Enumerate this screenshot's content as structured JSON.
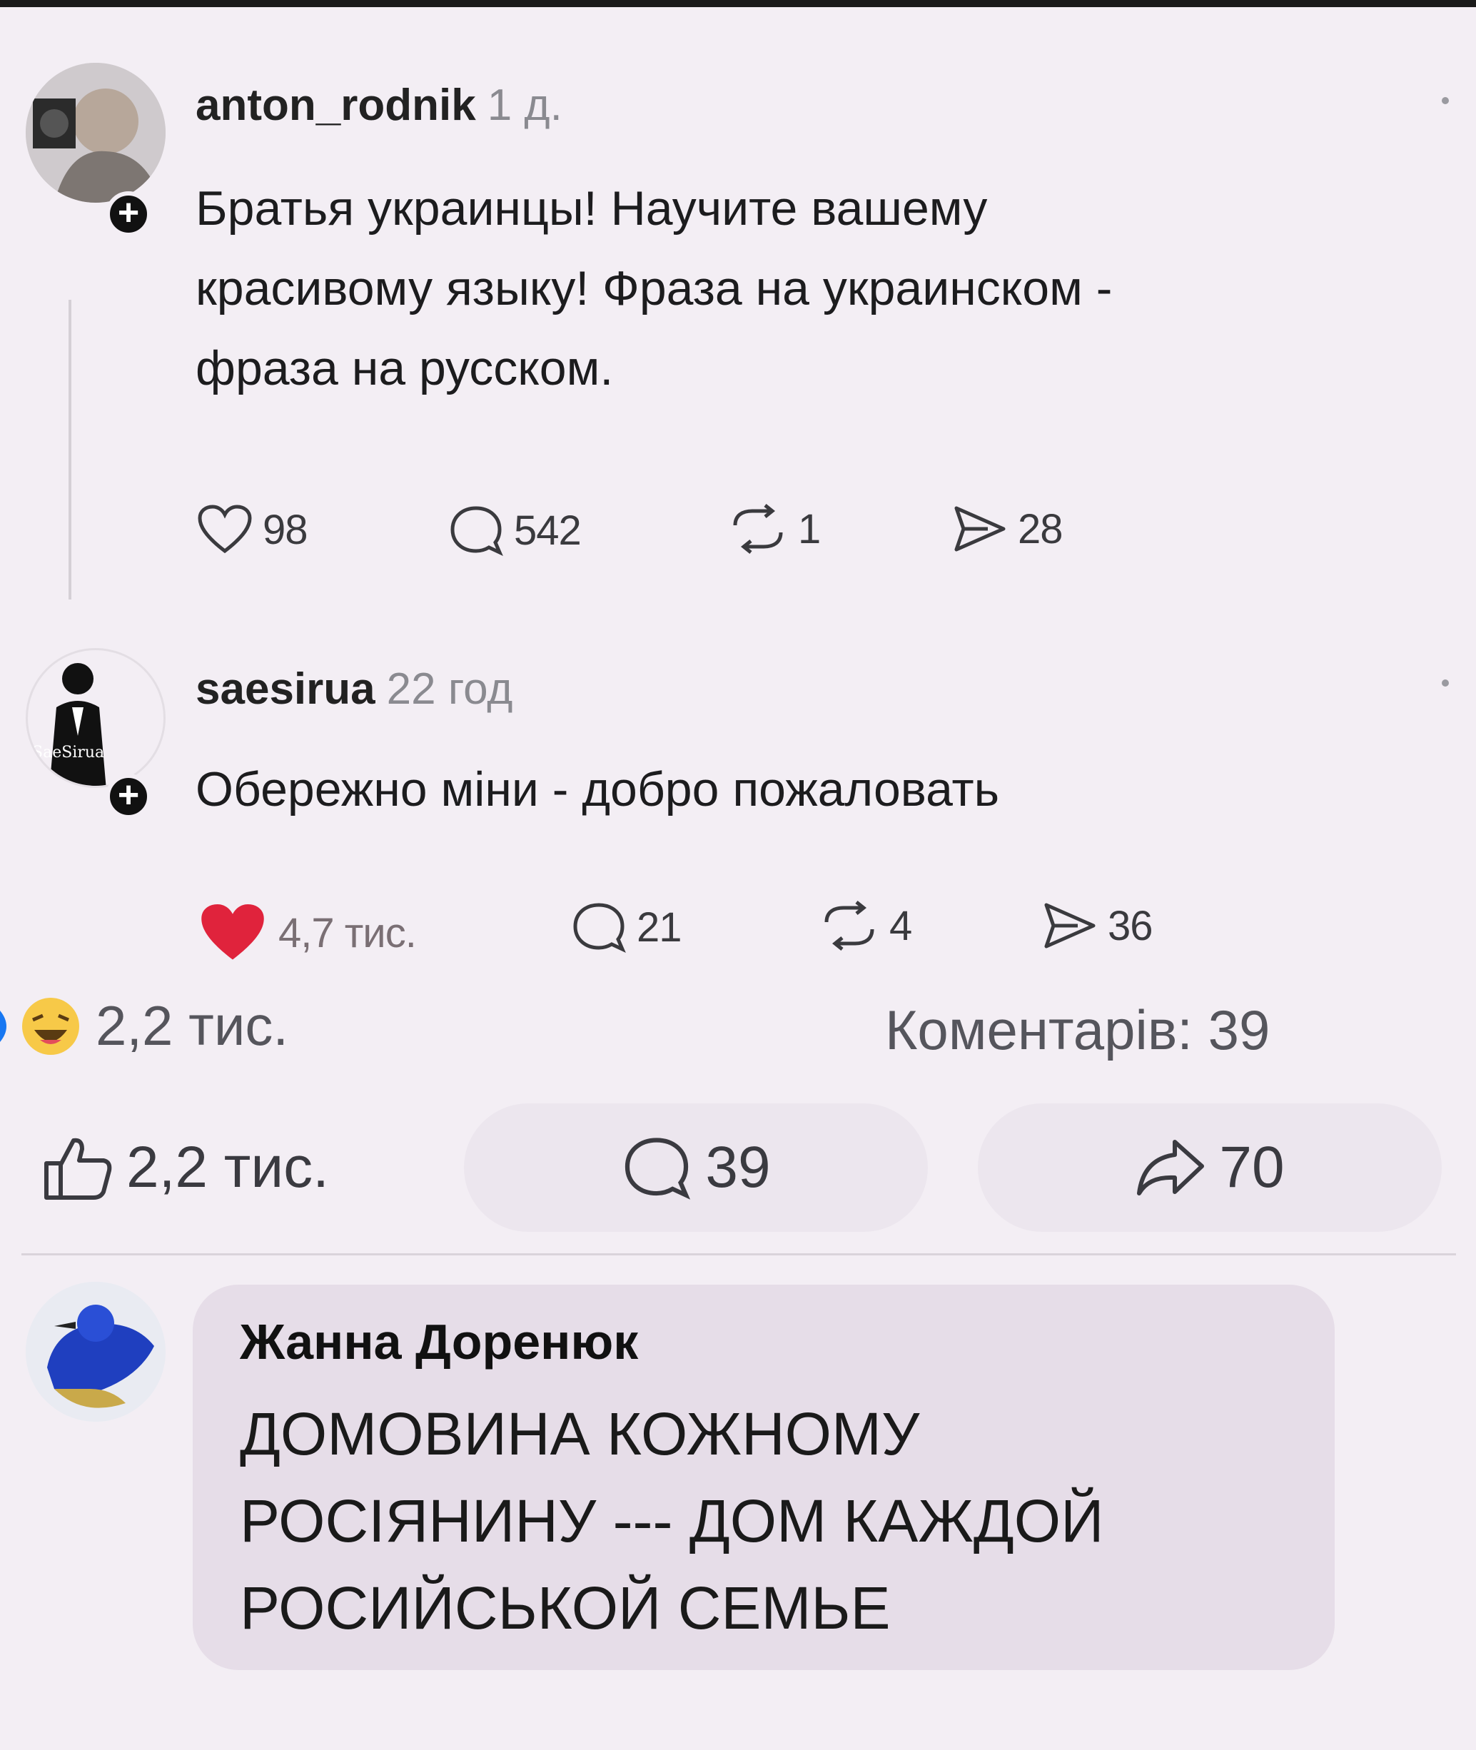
{
  "post1": {
    "username": "anton_rodnik",
    "time": "1 д.",
    "text_lines": [
      "Братья украинцы! Научите вашему",
      "красивому языку! Фраза на украинском -",
      "фраза на русском."
    ],
    "likes": "98",
    "comments": "542",
    "reposts": "1",
    "shares": "28"
  },
  "post2": {
    "username": "saesirua",
    "time": "22 год",
    "avatar_caption": "SaeSirua",
    "text": "Обережно міни - добро пожаловать",
    "likes": "4,7 тис.",
    "comments": "21",
    "reposts": "4",
    "shares": "36"
  },
  "summary": {
    "reactions_count": "2,2 тис.",
    "comments_count": "Коментарів: 39"
  },
  "actions": {
    "like_label": "2,2 тис.",
    "comment_label": "39",
    "share_label": "70"
  },
  "comment": {
    "author": "Жанна Доренюк",
    "text_lines": [
      "ДОМОВИНА КОЖНОМУ",
      "РОСІЯНИНУ --- ДОМ КАЖДОЙ",
      "РОСИЙСЬКОЙ СЕМЬЕ"
    ]
  },
  "colors": {
    "background": "#f3eef4",
    "heart_filled": "#e0233c",
    "bubble": "#e6dde8"
  },
  "icons": [
    "heart-icon",
    "comment-icon",
    "repost-icon",
    "share-icon",
    "thumbs-up-icon",
    "haha-emoji-icon",
    "plus-icon"
  ]
}
